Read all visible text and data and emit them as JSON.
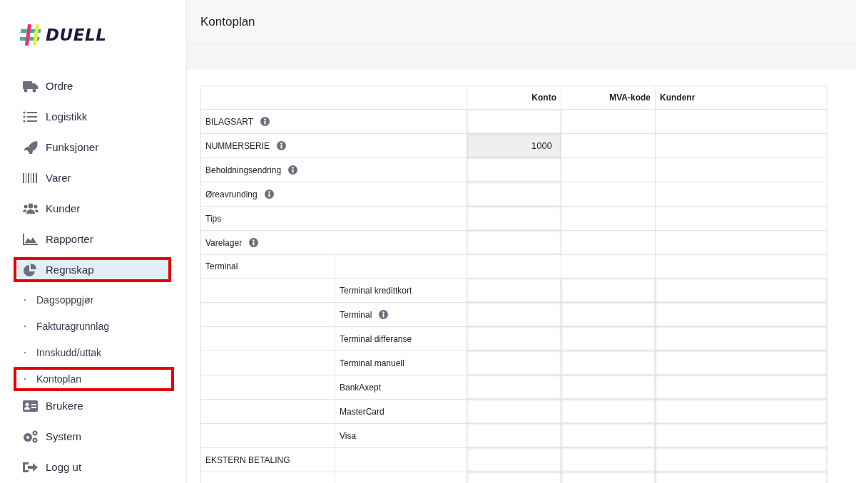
{
  "logo": {
    "text": "DUELL"
  },
  "sidebar": {
    "items": [
      {
        "label": "Ordre",
        "selected": false,
        "highlighted": false
      },
      {
        "label": "Logistikk",
        "selected": false,
        "highlighted": false
      },
      {
        "label": "Funksjoner",
        "selected": false,
        "highlighted": false
      },
      {
        "label": "Varer",
        "selected": false,
        "highlighted": false
      },
      {
        "label": "Kunder",
        "selected": false,
        "highlighted": false
      },
      {
        "label": "Rapporter",
        "selected": false,
        "highlighted": false
      },
      {
        "label": "Regnskap",
        "selected": true,
        "highlighted": true,
        "children": [
          {
            "label": "Dagsoppgjør",
            "selected": false,
            "highlighted": false
          },
          {
            "label": "Fakturagrunnlag",
            "selected": false,
            "highlighted": false
          },
          {
            "label": "Innskudd/uttak",
            "selected": false,
            "highlighted": false
          },
          {
            "label": "Kontoplan",
            "selected": false,
            "highlighted": true
          }
        ]
      },
      {
        "label": "Brukere",
        "selected": false,
        "highlighted": false
      },
      {
        "label": "System",
        "selected": false,
        "highlighted": false
      },
      {
        "label": "Logg ut",
        "selected": false,
        "highlighted": false
      }
    ]
  },
  "page": {
    "title": "Kontoplan"
  },
  "table": {
    "columns": [
      "Konto",
      "MVA-kode",
      "Kundenr"
    ],
    "rows": [
      {
        "kind": "top",
        "label": "BILAGSART",
        "info": true,
        "konto": {
          "disabled": false
        }
      },
      {
        "kind": "top",
        "label": "NUMMERSERIE",
        "info": true,
        "konto": {
          "value": "1000",
          "disabled": true
        }
      },
      {
        "kind": "top",
        "label": "Beholdningsendring",
        "info": true,
        "konto": {
          "disabled": false
        }
      },
      {
        "kind": "top",
        "label": "Øreavrunding",
        "info": true,
        "konto": {
          "disabled": false
        }
      },
      {
        "kind": "top",
        "label": "Tips",
        "info": false,
        "konto": {
          "disabled": false
        }
      },
      {
        "kind": "top",
        "label": "Varelager",
        "info": true,
        "konto": {
          "disabled": false
        }
      },
      {
        "kind": "group",
        "label": "Terminal",
        "info": false
      },
      {
        "kind": "sub",
        "label": "Terminal kredittkort",
        "info": false
      },
      {
        "kind": "sub",
        "label": "Terminal",
        "info": true
      },
      {
        "kind": "sub",
        "label": "Terminal differanse",
        "info": false
      },
      {
        "kind": "sub",
        "label": "Terminal manuell",
        "info": false
      },
      {
        "kind": "sub",
        "label": "BankAxept",
        "info": false
      },
      {
        "kind": "sub",
        "label": "MasterCard",
        "info": false
      },
      {
        "kind": "sub",
        "label": "Visa",
        "info": false
      },
      {
        "kind": "main",
        "label": "EKSTERN BETALING",
        "info": false
      },
      {
        "kind": "blank"
      }
    ]
  }
}
